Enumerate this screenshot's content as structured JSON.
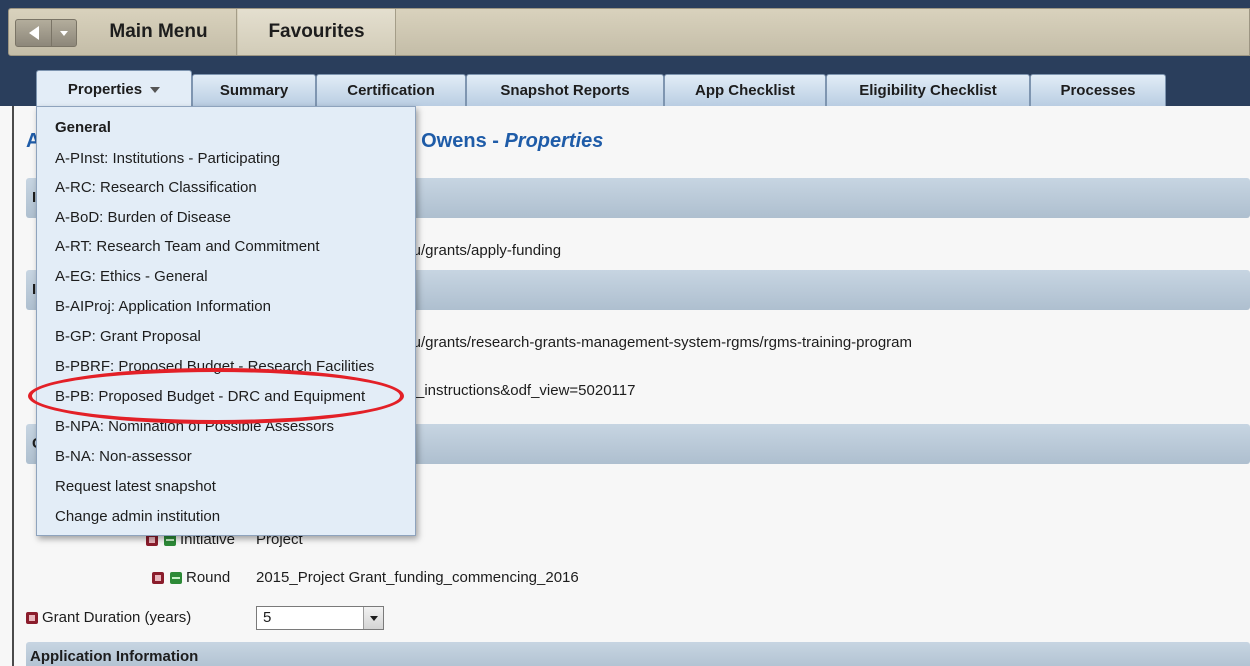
{
  "topbar": {
    "main_menu": "Main Menu",
    "favourites": "Favourites"
  },
  "tabs": {
    "properties": "Properties",
    "summary": "Summary",
    "certification": "Certification",
    "snapshot_reports": "Snapshot Reports",
    "app_checklist": "App Checklist",
    "eligibility_checklist": "Eligibility Checklist",
    "processes": "Processes"
  },
  "page": {
    "title_prefix": "A",
    "title_name": "l Owens - ",
    "title_section": "Properties"
  },
  "content": {
    "link1": "/.au/grants/apply-funding",
    "link2": "/.au/grants/research-grants-management-system-rgms/rgms-training-program",
    "link3": "nts_instructions&odf_view=5020117",
    "initiative_label": "Initiative",
    "initiative_value": "Project",
    "round_label": "Round",
    "round_value": "2015_Project Grant_funding_commencing_2016",
    "duration_label": "Grant Duration (years)",
    "duration_value": "5",
    "section_bottom": "Application Information",
    "section_left_letters": [
      "I",
      "I",
      "C"
    ]
  },
  "dropdown": {
    "items": [
      "General",
      "A-PInst: Institutions - Participating",
      "A-RC: Research Classification",
      "A-BoD: Burden of Disease",
      "A-RT: Research Team and Commitment",
      "A-EG: Ethics - General",
      "B-AIProj: Application Information",
      "B-GP: Grant Proposal",
      "B-PBRF: Proposed Budget - Research Facilities",
      "B-PB: Proposed Budget - DRC and Equipment",
      "B-NPA: Nomination of Possible Assessors",
      "B-NA: Non-assessor",
      "Request latest snapshot",
      "Change admin institution"
    ]
  },
  "colors": {
    "header_dark": "#2a3e5c",
    "title_blue": "#1f5ca8",
    "highlight_red": "#e32027"
  }
}
